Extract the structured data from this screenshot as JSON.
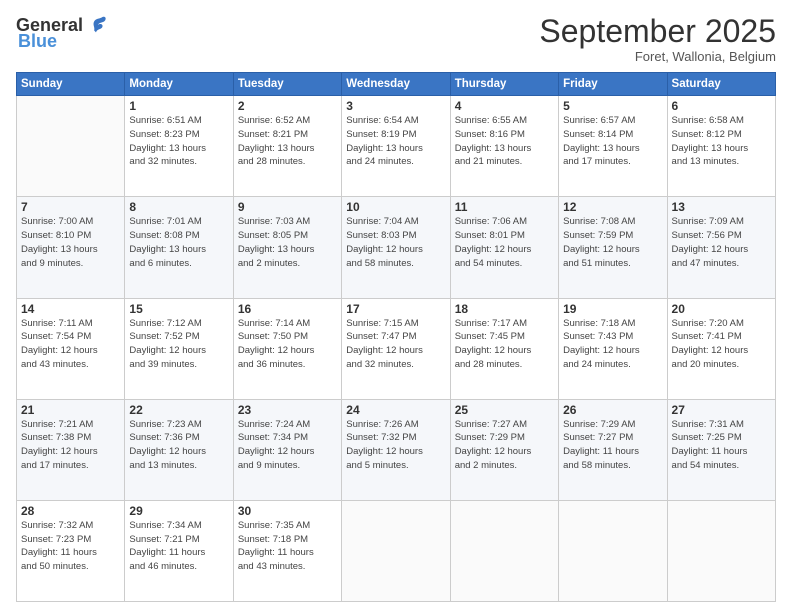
{
  "header": {
    "logo_general": "General",
    "logo_blue": "Blue",
    "month_title": "September 2025",
    "subtitle": "Foret, Wallonia, Belgium"
  },
  "days_of_week": [
    "Sunday",
    "Monday",
    "Tuesday",
    "Wednesday",
    "Thursday",
    "Friday",
    "Saturday"
  ],
  "weeks": [
    [
      {
        "day": "",
        "info": ""
      },
      {
        "day": "1",
        "info": "Sunrise: 6:51 AM\nSunset: 8:23 PM\nDaylight: 13 hours\nand 32 minutes."
      },
      {
        "day": "2",
        "info": "Sunrise: 6:52 AM\nSunset: 8:21 PM\nDaylight: 13 hours\nand 28 minutes."
      },
      {
        "day": "3",
        "info": "Sunrise: 6:54 AM\nSunset: 8:19 PM\nDaylight: 13 hours\nand 24 minutes."
      },
      {
        "day": "4",
        "info": "Sunrise: 6:55 AM\nSunset: 8:16 PM\nDaylight: 13 hours\nand 21 minutes."
      },
      {
        "day": "5",
        "info": "Sunrise: 6:57 AM\nSunset: 8:14 PM\nDaylight: 13 hours\nand 17 minutes."
      },
      {
        "day": "6",
        "info": "Sunrise: 6:58 AM\nSunset: 8:12 PM\nDaylight: 13 hours\nand 13 minutes."
      }
    ],
    [
      {
        "day": "7",
        "info": "Sunrise: 7:00 AM\nSunset: 8:10 PM\nDaylight: 13 hours\nand 9 minutes."
      },
      {
        "day": "8",
        "info": "Sunrise: 7:01 AM\nSunset: 8:08 PM\nDaylight: 13 hours\nand 6 minutes."
      },
      {
        "day": "9",
        "info": "Sunrise: 7:03 AM\nSunset: 8:05 PM\nDaylight: 13 hours\nand 2 minutes."
      },
      {
        "day": "10",
        "info": "Sunrise: 7:04 AM\nSunset: 8:03 PM\nDaylight: 12 hours\nand 58 minutes."
      },
      {
        "day": "11",
        "info": "Sunrise: 7:06 AM\nSunset: 8:01 PM\nDaylight: 12 hours\nand 54 minutes."
      },
      {
        "day": "12",
        "info": "Sunrise: 7:08 AM\nSunset: 7:59 PM\nDaylight: 12 hours\nand 51 minutes."
      },
      {
        "day": "13",
        "info": "Sunrise: 7:09 AM\nSunset: 7:56 PM\nDaylight: 12 hours\nand 47 minutes."
      }
    ],
    [
      {
        "day": "14",
        "info": "Sunrise: 7:11 AM\nSunset: 7:54 PM\nDaylight: 12 hours\nand 43 minutes."
      },
      {
        "day": "15",
        "info": "Sunrise: 7:12 AM\nSunset: 7:52 PM\nDaylight: 12 hours\nand 39 minutes."
      },
      {
        "day": "16",
        "info": "Sunrise: 7:14 AM\nSunset: 7:50 PM\nDaylight: 12 hours\nand 36 minutes."
      },
      {
        "day": "17",
        "info": "Sunrise: 7:15 AM\nSunset: 7:47 PM\nDaylight: 12 hours\nand 32 minutes."
      },
      {
        "day": "18",
        "info": "Sunrise: 7:17 AM\nSunset: 7:45 PM\nDaylight: 12 hours\nand 28 minutes."
      },
      {
        "day": "19",
        "info": "Sunrise: 7:18 AM\nSunset: 7:43 PM\nDaylight: 12 hours\nand 24 minutes."
      },
      {
        "day": "20",
        "info": "Sunrise: 7:20 AM\nSunset: 7:41 PM\nDaylight: 12 hours\nand 20 minutes."
      }
    ],
    [
      {
        "day": "21",
        "info": "Sunrise: 7:21 AM\nSunset: 7:38 PM\nDaylight: 12 hours\nand 17 minutes."
      },
      {
        "day": "22",
        "info": "Sunrise: 7:23 AM\nSunset: 7:36 PM\nDaylight: 12 hours\nand 13 minutes."
      },
      {
        "day": "23",
        "info": "Sunrise: 7:24 AM\nSunset: 7:34 PM\nDaylight: 12 hours\nand 9 minutes."
      },
      {
        "day": "24",
        "info": "Sunrise: 7:26 AM\nSunset: 7:32 PM\nDaylight: 12 hours\nand 5 minutes."
      },
      {
        "day": "25",
        "info": "Sunrise: 7:27 AM\nSunset: 7:29 PM\nDaylight: 12 hours\nand 2 minutes."
      },
      {
        "day": "26",
        "info": "Sunrise: 7:29 AM\nSunset: 7:27 PM\nDaylight: 11 hours\nand 58 minutes."
      },
      {
        "day": "27",
        "info": "Sunrise: 7:31 AM\nSunset: 7:25 PM\nDaylight: 11 hours\nand 54 minutes."
      }
    ],
    [
      {
        "day": "28",
        "info": "Sunrise: 7:32 AM\nSunset: 7:23 PM\nDaylight: 11 hours\nand 50 minutes."
      },
      {
        "day": "29",
        "info": "Sunrise: 7:34 AM\nSunset: 7:21 PM\nDaylight: 11 hours\nand 46 minutes."
      },
      {
        "day": "30",
        "info": "Sunrise: 7:35 AM\nSunset: 7:18 PM\nDaylight: 11 hours\nand 43 minutes."
      },
      {
        "day": "",
        "info": ""
      },
      {
        "day": "",
        "info": ""
      },
      {
        "day": "",
        "info": ""
      },
      {
        "day": "",
        "info": ""
      }
    ]
  ]
}
